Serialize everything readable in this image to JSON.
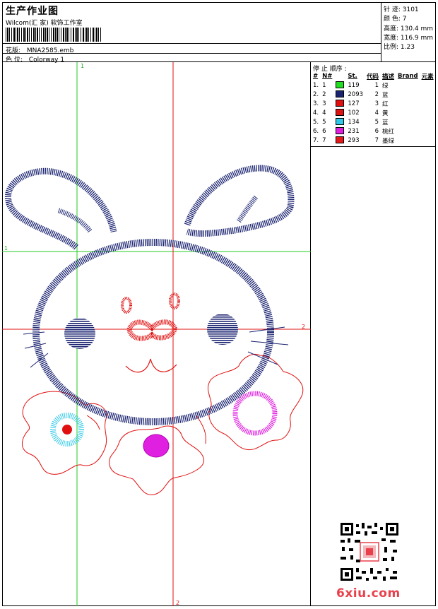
{
  "header": {
    "title": "生产作业图",
    "company": "Wilcom(汇 家) 软饰工作室",
    "design_label": "花版:",
    "design_value": "MNA2585.emb",
    "colorway_label": "色 位:",
    "colorway_value": "Colorway 1"
  },
  "stats": {
    "stitches": "针 迹: 3101",
    "colors": "颜 色: 7",
    "height": "高度: 130.4 mm",
    "width": "宽度: 116.9 mm",
    "scale": "比例: 1.23"
  },
  "legend": {
    "title": "停 止 顺序 :",
    "columns": [
      "#",
      "N#",
      "",
      "St.",
      "代码",
      "描述",
      "Brand",
      "元素"
    ],
    "rows": [
      {
        "idx": "1.",
        "num": "1",
        "color": "#22dd22",
        "st": "119",
        "code": "1",
        "desc": "绿"
      },
      {
        "idx": "2.",
        "num": "2",
        "color": "#1a2370",
        "st": "2093",
        "code": "2",
        "desc": "蓝"
      },
      {
        "idx": "3.",
        "num": "3",
        "color": "#e01010",
        "st": "127",
        "code": "3",
        "desc": "红"
      },
      {
        "idx": "4.",
        "num": "4",
        "color": "#dd1414",
        "st": "102",
        "code": "4",
        "desc": "黄"
      },
      {
        "idx": "5.",
        "num": "5",
        "color": "#30c8e8",
        "st": "134",
        "code": "5",
        "desc": "蓝"
      },
      {
        "idx": "6.",
        "num": "6",
        "color": "#e020e0",
        "st": "231",
        "code": "6",
        "desc": "桃红"
      },
      {
        "idx": "7.",
        "num": "7",
        "color": "#e21a1a",
        "st": "293",
        "code": "7",
        "desc": "墨绿"
      }
    ]
  },
  "guides": {
    "v1_label": "1",
    "h1_label": "1",
    "h2_label": "2",
    "v2_label": "2"
  },
  "colors": {
    "navy": "#1a2370",
    "red": "#e01010",
    "green": "#22cc22",
    "cyan": "#30c8e8",
    "magenta": "#e020e0"
  },
  "footer": {
    "site": "6xiu.com",
    "qr_icon": "qr-code-icon"
  }
}
